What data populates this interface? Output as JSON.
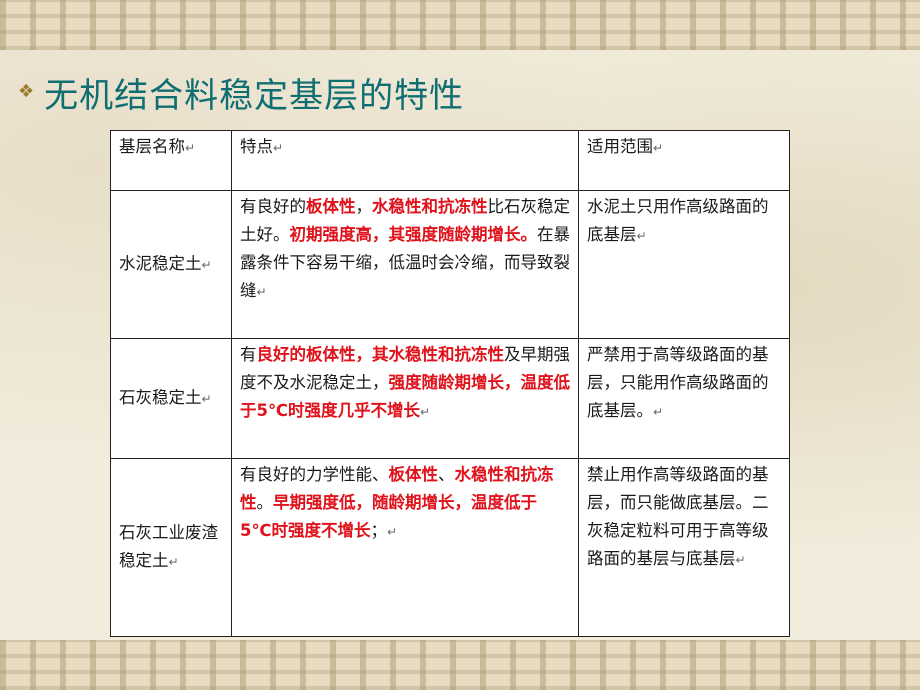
{
  "slide": {
    "title": "无机结合料稳定基层的特性",
    "bullet_icon": "diamond-dots-bullet-icon",
    "accent_color": "#0f6e72"
  },
  "table": {
    "header": {
      "name": "基层名称",
      "features": "特点",
      "scope": "适用范围"
    },
    "rows": [
      {
        "name": "水泥稳定土",
        "features": [
          {
            "t": "有良好的",
            "red": false
          },
          {
            "t": "板体性",
            "red": true
          },
          {
            "t": "，",
            "red": false
          },
          {
            "t": "水稳性和抗冻性",
            "red": true
          },
          {
            "t": "比石灰稳定土好。",
            "red": false
          },
          {
            "t": "初期强度高，其强度随龄期增长。",
            "red": true
          },
          {
            "t": "在暴露条件下容易干缩，低温时会冷缩，而导致裂缝",
            "red": false
          }
        ],
        "scope": "水泥土只用作高级路面的底基层"
      },
      {
        "name": "石灰稳定土",
        "features": [
          {
            "t": "有",
            "red": false
          },
          {
            "t": "良好的板体性",
            "red": true
          },
          {
            "t": "，其水稳性和抗冻性",
            "red": true
          },
          {
            "t": "及早期强度不及水泥稳定土，",
            "red": false
          },
          {
            "t": "强度随龄期增长，温度低于5℃时强度几乎不增长",
            "red": true
          }
        ],
        "scope": "严禁用于高等级路面的基层，只能用作高级路面的底基层。"
      },
      {
        "name": "石灰工业废渣稳定土",
        "features": [
          {
            "t": "有良好的力学性能、",
            "red": false
          },
          {
            "t": "板体性",
            "red": true
          },
          {
            "t": "、",
            "red": false
          },
          {
            "t": "水稳性和抗冻性",
            "red": true
          },
          {
            "t": "。",
            "red": false
          },
          {
            "t": "早期强度低，随龄期增长，温度低于 5℃时强度不增长",
            "red": true
          },
          {
            "t": "；",
            "red": false
          }
        ],
        "scope": "禁止用作高等级路面的基层，而只能做底基层。二灰稳定粒料可用于高等级路面的基层与底基层"
      }
    ]
  }
}
